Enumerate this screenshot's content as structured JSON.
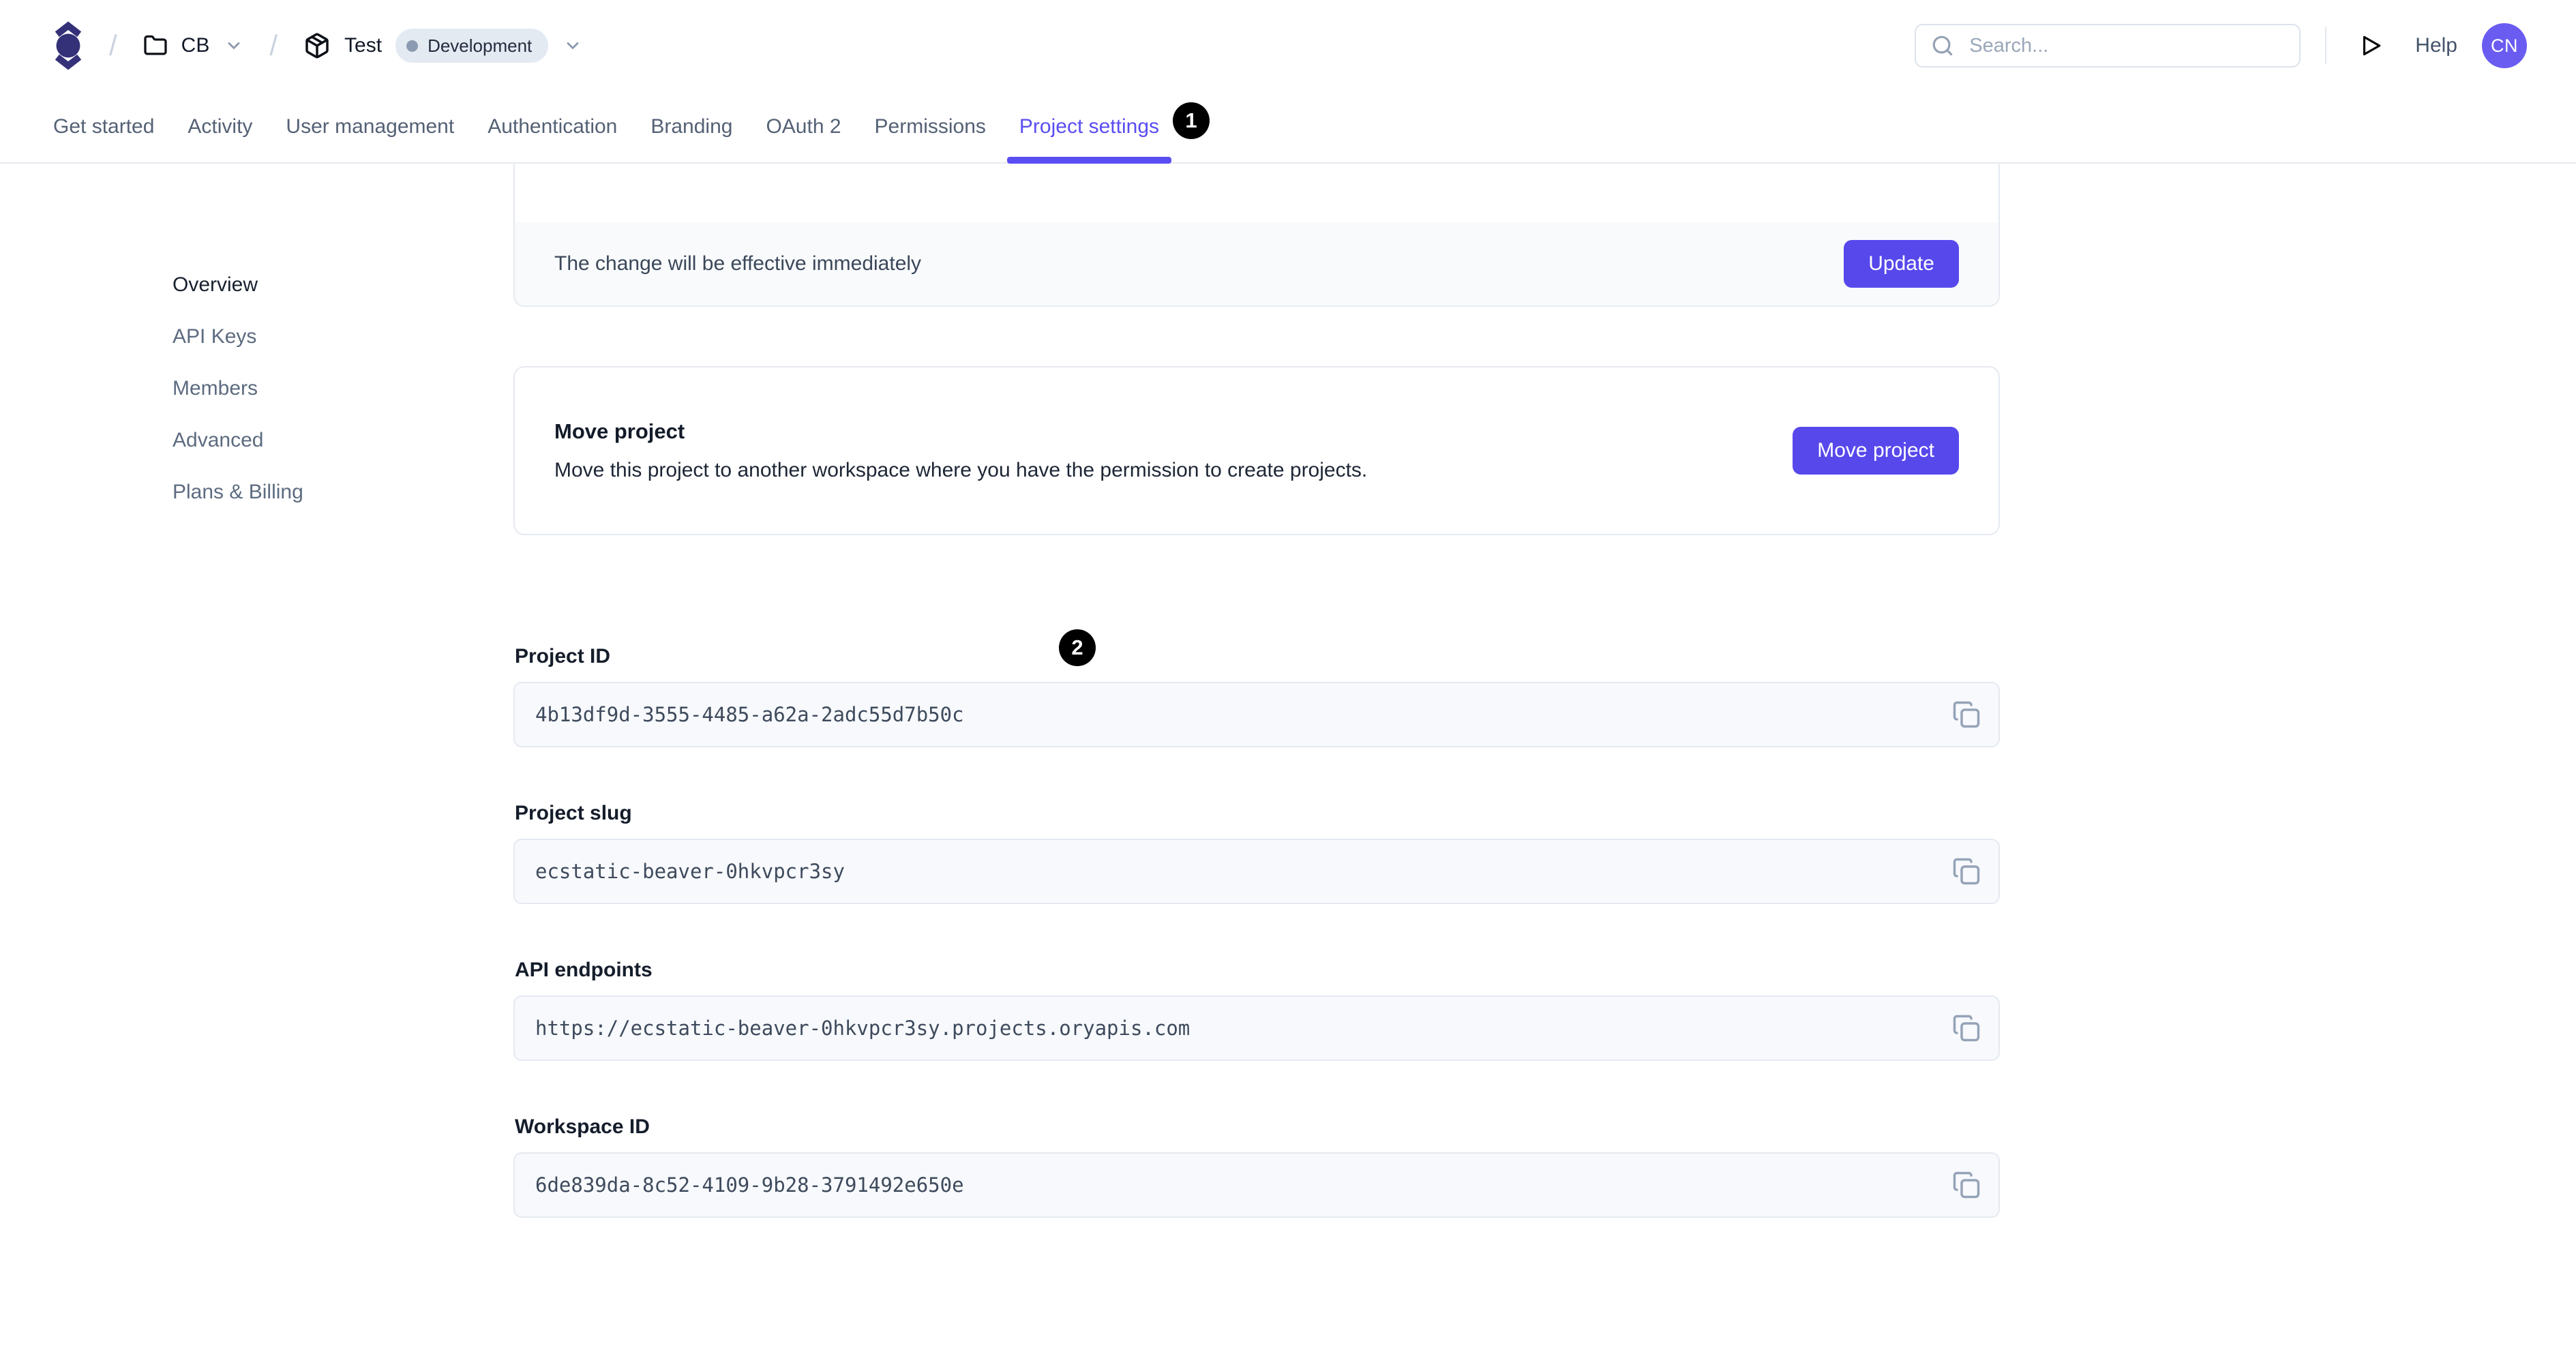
{
  "header": {
    "breadcrumb": {
      "separator": "/",
      "workspace_label": "CB",
      "project_label": "Test",
      "environment_label": "Development"
    },
    "search_placeholder": "Search...",
    "help_label": "Help",
    "avatar_initials": "CN"
  },
  "tabs": [
    {
      "label": "Get started",
      "active": false
    },
    {
      "label": "Activity",
      "active": false
    },
    {
      "label": "User management",
      "active": false
    },
    {
      "label": "Authentication",
      "active": false
    },
    {
      "label": "Branding",
      "active": false
    },
    {
      "label": "OAuth 2",
      "active": false
    },
    {
      "label": "Permissions",
      "active": false
    },
    {
      "label": "Project settings",
      "active": true
    }
  ],
  "sidebar": {
    "items": [
      {
        "label": "Overview",
        "active": true
      },
      {
        "label": "API Keys",
        "active": false
      },
      {
        "label": "Members",
        "active": false
      },
      {
        "label": "Advanced",
        "active": false
      },
      {
        "label": "Plans & Billing",
        "active": false
      }
    ]
  },
  "cards": {
    "update_notice": {
      "message": "The change will be effective immediately",
      "button_label": "Update"
    },
    "move_project": {
      "title": "Move project",
      "description": "Move this project to another workspace where you have the permission to create projects.",
      "button_label": "Move project"
    }
  },
  "fields": [
    {
      "label": "Project ID",
      "value": "4b13df9d-3555-4485-a62a-2adc55d7b50c"
    },
    {
      "label": "Project slug",
      "value": "ecstatic-beaver-0hkvpcr3sy"
    },
    {
      "label": "API endpoints",
      "value": "https://ecstatic-beaver-0hkvpcr3sy.projects.oryapis.com"
    },
    {
      "label": "Workspace ID",
      "value": "6de839da-8c52-4109-9b28-3791492e650e"
    }
  ],
  "annotations": [
    {
      "number": "1"
    },
    {
      "number": "2"
    }
  ],
  "icons": [
    "ory-logo",
    "folder-icon",
    "chevron-down-icon",
    "package-icon",
    "search-icon",
    "play-icon",
    "copy-icon",
    "status-dot"
  ],
  "colors": {
    "accent": "#5748ec",
    "tab_active": "#5a4df2",
    "logo": "#343178",
    "env_badge_bg": "#e4eaf2",
    "env_badge_dot": "#8b9bb1",
    "avatar_bg": "#6a5cf1",
    "field_bg": "#f7f9fc",
    "card_footer_bg": "#f8fafc",
    "border": "#e6eaf0",
    "annotation_bg": "#000000"
  }
}
